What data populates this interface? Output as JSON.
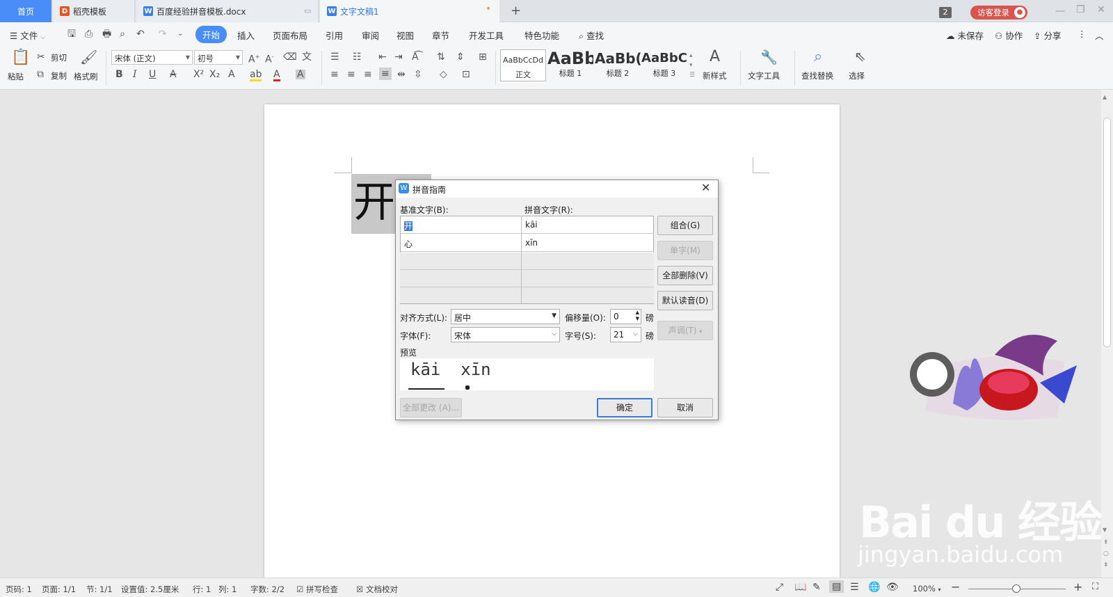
{
  "tabs": {
    "home": "首页",
    "t1": "稻壳模板",
    "t2": "百度经验拼音模板.docx",
    "t3": "文字文稿1",
    "add": "+",
    "count": "2",
    "login": "访客登录"
  },
  "menu": {
    "file": "文件",
    "items": [
      "开始",
      "插入",
      "页面布局",
      "引用",
      "审阅",
      "视图",
      "章节",
      "开发工具",
      "特色功能"
    ],
    "search": "查找",
    "unsaved": "未保存",
    "collab": "协作",
    "share": "分享"
  },
  "toolbar": {
    "paste": "粘贴",
    "cut": "剪切",
    "copy": "复制",
    "format_painter": "格式刷",
    "font": "宋体 (正文)",
    "size": "初号",
    "styles": [
      {
        "preview": "AaBbCcDd",
        "name": "正文"
      },
      {
        "preview": "AaBb",
        "name": "标题 1"
      },
      {
        "preview": "AaBb(",
        "name": "标题 2"
      },
      {
        "preview": "AaBbC",
        "name": "标题 3"
      }
    ],
    "new_style": "新样式",
    "text_tools": "文字工具",
    "find_replace": "查找替换",
    "select": "选择"
  },
  "document": {
    "char": "开"
  },
  "dialog": {
    "title": "拼音指南",
    "base_label": "基准文字(B):",
    "ruby_label": "拼音文字(R):",
    "rows": [
      {
        "base": "开",
        "ruby": "kāi"
      },
      {
        "base": "心",
        "ruby": "xīn"
      },
      {
        "base": "",
        "ruby": ""
      },
      {
        "base": "",
        "ruby": ""
      },
      {
        "base": "",
        "ruby": ""
      }
    ],
    "btn_group": "组合(G)",
    "btn_single": "单字(M)",
    "btn_clear": "全部删除(V)",
    "btn_default": "默认读音(D)",
    "btn_tone": "声调(T)",
    "align_label": "对齐方式(L):",
    "align_value": "居中",
    "offset_label": "偏移量(O):",
    "offset_value": "0",
    "font_label": "字体(F):",
    "font_value": "宋体",
    "size_label": "字号(S):",
    "size_value": "21",
    "unit": "磅",
    "preview_label": "预览",
    "preview_text": "kāi  xīn",
    "btn_all": "全部更改 (A)...",
    "btn_ok": "确定",
    "btn_cancel": "取消"
  },
  "status": {
    "page": "页码: 1",
    "pages": "页面: 1/1",
    "section": "节: 1/1",
    "setting": "设置值: 2.5厘米",
    "row": "行: 1",
    "col": "列: 1",
    "words": "字数: 2/2",
    "spell": "拼写检查",
    "proof": "文档校对",
    "zoom": "100%"
  },
  "watermark": {
    "brand": "Bai du 经验",
    "url": "jingyan.baidu.com"
  },
  "colors": {
    "accent": "#4b8df8",
    "login": "#d9534f"
  }
}
